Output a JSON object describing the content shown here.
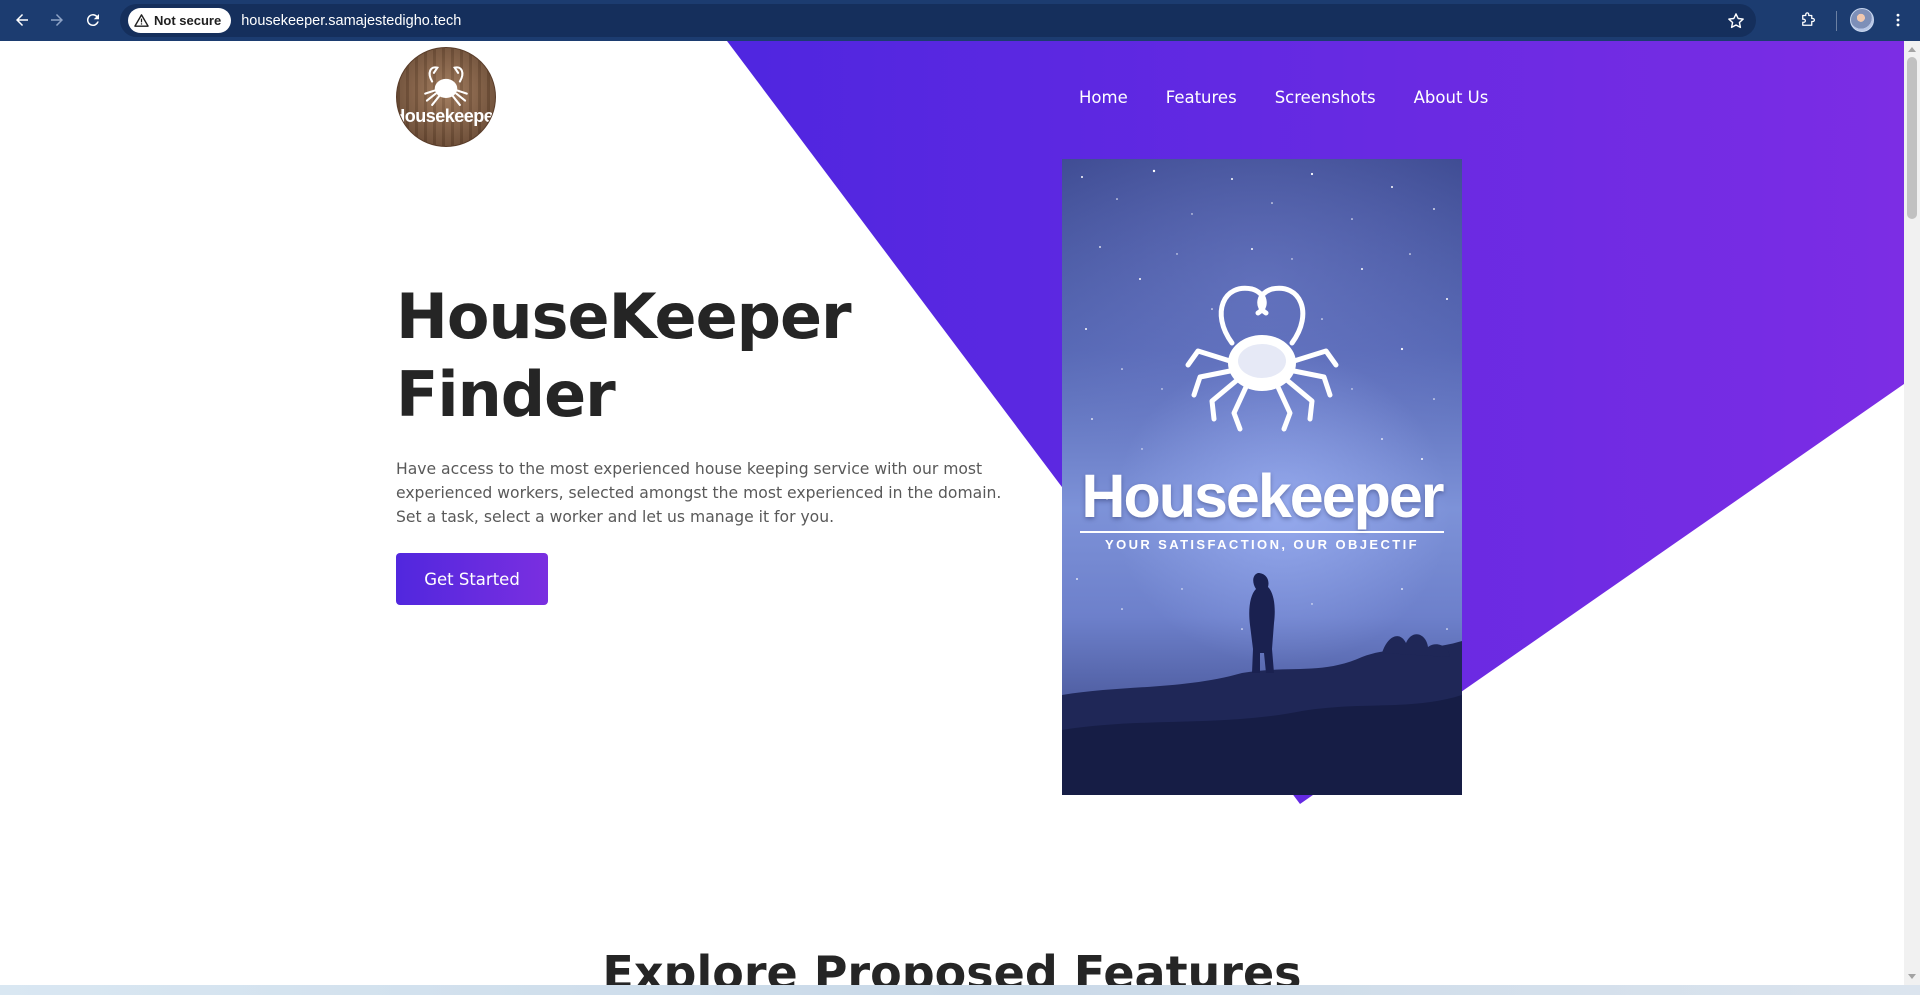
{
  "browser": {
    "security_label": "Not secure",
    "url": "housekeeper.samajestedigho.tech"
  },
  "site": {
    "logo_text": "Housekeeper",
    "nav": [
      {
        "label": "Home"
      },
      {
        "label": "Features"
      },
      {
        "label": "Screenshots"
      },
      {
        "label": "About Us"
      }
    ],
    "hero": {
      "title_line1": "HouseKeeper",
      "title_line2": "Finder",
      "description": "Have access to the most experienced house keeping service with our most experienced workers, selected amongst the most experienced in the domain. Set a task, select a worker and let us manage it for you.",
      "cta_label": "Get Started"
    },
    "poster": {
      "wordmark": "Housekeeper",
      "tagline": "YOUR SATISFACTION, OUR OBJECTIF"
    },
    "features_heading": "Explore Proposed Features"
  },
  "colors": {
    "chrome_bg": "#1c3c70",
    "hero_purple_start": "#4f26e0",
    "hero_purple_end": "#7c2de4",
    "heading_text": "#252525",
    "body_text": "#595959"
  },
  "icons": {
    "back": "arrow-left-icon",
    "forward": "arrow-right-icon",
    "reload": "reload-icon",
    "warning": "warning-triangle-icon",
    "bookmark": "star-icon",
    "extensions": "puzzle-icon",
    "menu": "kebab-menu-icon"
  }
}
